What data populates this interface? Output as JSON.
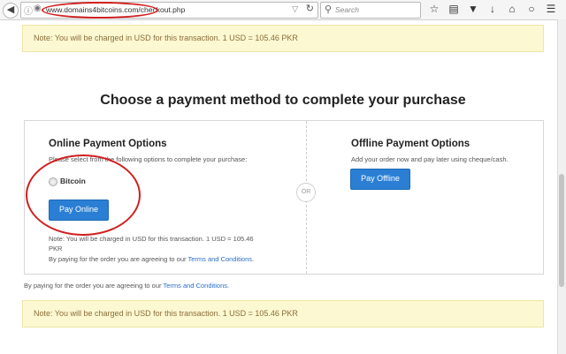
{
  "browser": {
    "url": "www.domains4bitcoins.com/checkout.php",
    "search_placeholder": "Search",
    "toolbar_icons": [
      "star-icon",
      "clipboard-icon",
      "pocket-icon",
      "download-icon",
      "home-icon",
      "chat-icon"
    ]
  },
  "note_text": "Note: You will be charged in USD for this transaction. 1 USD = 105.46 PKR",
  "page_heading": "Choose a payment method to complete your purchase",
  "online": {
    "title": "Online Payment Options",
    "instruction": "Please select from the following options to complete your purchase:",
    "option_label": "Bitcoin",
    "button": "Pay Online",
    "note_line1": "Note: You will be charged in USD for this transaction. 1 USD = 105.46",
    "note_line2": "PKR",
    "terms_prefix": "By paying for the order you are agreeing to our ",
    "terms_link": "Terms and Conditions",
    "terms_suffix": "."
  },
  "or_label": "OR",
  "offline": {
    "title": "Offline Payment Options",
    "instruction": "Add your order now and pay later using cheque/cash.",
    "button": "Pay Offline"
  },
  "footer_terms": {
    "prefix": "By paying for the order you are agreeing to our ",
    "link": "Terms and Conditions",
    "suffix": "."
  },
  "colors": {
    "annotation": "#d21f1f",
    "button": "#2a7fd4",
    "note_bg": "#fcf8d1"
  }
}
